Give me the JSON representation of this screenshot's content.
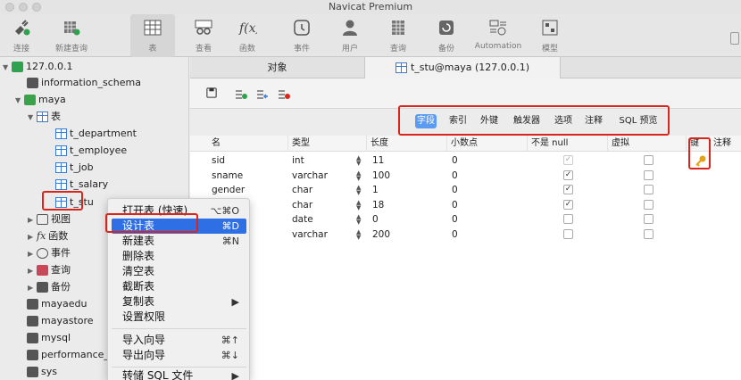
{
  "window": {
    "title": "Navicat Premium"
  },
  "toolbar": {
    "items": [
      {
        "label": "连接",
        "icon": "connection-plug-icon"
      },
      {
        "label": "新建查询",
        "icon": "new-query-icon"
      },
      {
        "label": "表",
        "icon": "table-grid-icon"
      },
      {
        "label": "查看",
        "icon": "view-glasses-icon"
      },
      {
        "label": "函数",
        "icon": "function-fx-icon"
      },
      {
        "label": "事件",
        "icon": "event-clock-icon"
      },
      {
        "label": "用户",
        "icon": "user-icon"
      },
      {
        "label": "查询",
        "icon": "query-grid-icon"
      },
      {
        "label": "备份",
        "icon": "backup-icon"
      },
      {
        "label": "Automation",
        "icon": "automation-icon"
      },
      {
        "label": "模型",
        "icon": "model-icon"
      }
    ]
  },
  "sidebar": {
    "connection": "127.0.0.1",
    "items": [
      {
        "label": "information_schema"
      },
      {
        "label": "maya"
      },
      {
        "label": "表"
      },
      {
        "label": "t_department"
      },
      {
        "label": "t_employee"
      },
      {
        "label": "t_job"
      },
      {
        "label": "t_salary"
      },
      {
        "label": "t_stu"
      },
      {
        "label": "视图"
      },
      {
        "label": "函数",
        "prefix": "fx"
      },
      {
        "label": "事件"
      },
      {
        "label": "查询"
      },
      {
        "label": "备份"
      },
      {
        "label": "mayaedu"
      },
      {
        "label": "mayastore"
      },
      {
        "label": "mysql"
      },
      {
        "label": "performance_"
      },
      {
        "label": "sys"
      }
    ]
  },
  "tabs": [
    {
      "label": "对象"
    },
    {
      "label": "t_stu@maya (127.0.0.1)"
    }
  ],
  "subtabs": [
    {
      "label": "字段"
    },
    {
      "label": "索引"
    },
    {
      "label": "外键"
    },
    {
      "label": "触发器"
    },
    {
      "label": "选项"
    },
    {
      "label": "注释"
    },
    {
      "label": "SQL 预览"
    }
  ],
  "grid": {
    "headers": [
      "名",
      "类型",
      "长度",
      "小数点",
      "不是 null",
      "虚拟",
      "键",
      "注释"
    ],
    "rows": [
      {
        "name": "sid",
        "type": "int",
        "length": "11",
        "decimals": "0",
        "notnull": true,
        "virtual": false,
        "key": true,
        "notnull_disabled": true
      },
      {
        "name": "sname",
        "type": "varchar",
        "length": "100",
        "decimals": "0",
        "notnull": true,
        "virtual": false,
        "key": false
      },
      {
        "name": "gender",
        "type": "char",
        "length": "1",
        "decimals": "0",
        "notnull": true,
        "virtual": false,
        "key": false
      },
      {
        "name": "",
        "type": "char",
        "length": "18",
        "decimals": "0",
        "notnull": true,
        "virtual": false,
        "key": false
      },
      {
        "name": "",
        "type": "date",
        "length": "0",
        "decimals": "0",
        "notnull": false,
        "virtual": false,
        "key": false
      },
      {
        "name": "",
        "type": "varchar",
        "length": "200",
        "decimals": "0",
        "notnull": false,
        "virtual": false,
        "key": false
      }
    ]
  },
  "context_menu": {
    "items": [
      {
        "label": "打开表 (快速)",
        "shortcut": "⌥⌘O"
      },
      {
        "label": "设计表",
        "shortcut": "⌘D",
        "selected": true
      },
      {
        "label": "新建表",
        "shortcut": "⌘N"
      },
      {
        "label": "删除表",
        "shortcut": ""
      },
      {
        "label": "清空表",
        "shortcut": ""
      },
      {
        "label": "截断表",
        "shortcut": ""
      },
      {
        "label": "复制表",
        "shortcut": "▶"
      },
      {
        "label": "设置权限",
        "shortcut": ""
      },
      {
        "label": "导入向导",
        "shortcut": "⌘↑"
      },
      {
        "label": "导出向导",
        "shortcut": "⌘↓"
      },
      {
        "label": "转储 SQL 文件",
        "shortcut": "▶"
      }
    ]
  },
  "colors": {
    "accent": "#2f6fe5",
    "highlight_red": "#d9261c",
    "key_gold": "#e3a316"
  }
}
